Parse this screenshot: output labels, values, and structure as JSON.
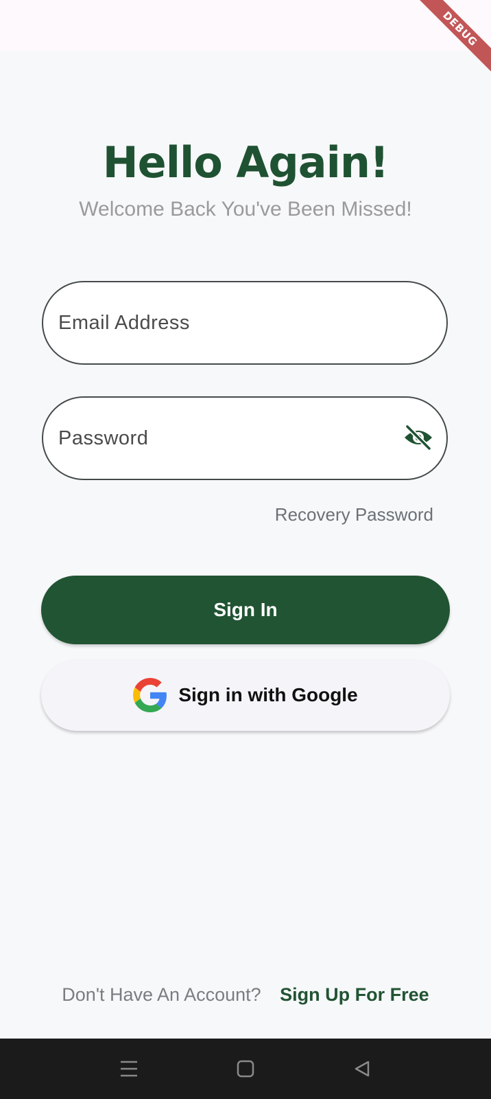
{
  "debug_banner": "DEBUG",
  "header": {
    "title": "Hello Again!",
    "subtitle": "Welcome Back You've Been Missed!"
  },
  "form": {
    "email_placeholder": "Email Address",
    "password_placeholder": "Password",
    "recovery_link": "Recovery Password"
  },
  "actions": {
    "sign_in_label": "Sign In",
    "google_label": "Sign in with Google"
  },
  "footer": {
    "prompt": "Don't Have An Account?",
    "signup_link": "Sign Up For Free"
  },
  "icons": {
    "password_toggle": "eye-off-icon",
    "google": "google-logo-icon",
    "nav_menu": "menu-icon",
    "nav_home": "home-square-icon",
    "nav_back": "back-triangle-icon"
  },
  "colors": {
    "brand_green": "#215433",
    "title_green": "#1f5232",
    "background": "#f7f8fa",
    "nav_bar": "#1b1b1b",
    "debug_ribbon": "#b43232"
  }
}
